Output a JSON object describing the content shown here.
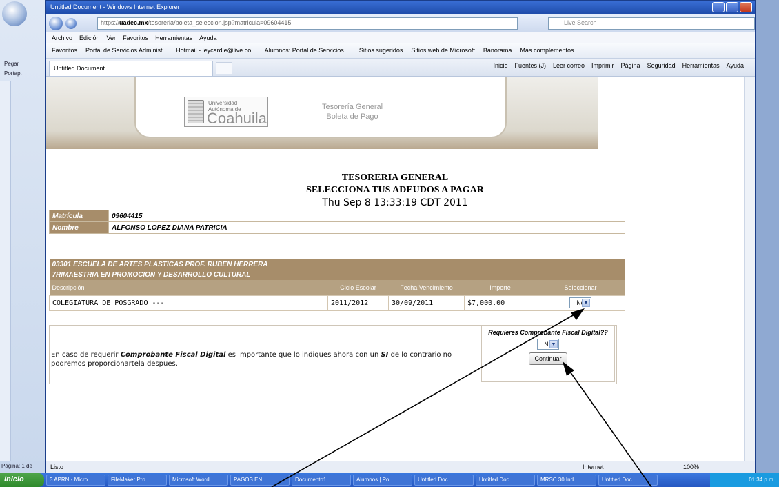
{
  "word": {
    "paste_label": "Pegar",
    "status_page": "Página: 1 de",
    "tools_label": "Portap."
  },
  "ie": {
    "title": "Untitled Document - Windows Internet Explorer",
    "address_prefix": "https://",
    "address_host": "uadec.mx",
    "address_rest": "/tesoreria/boleta_seleccion.jsp?matricula=09604415",
    "search_placeholder": "Live Search",
    "menu": [
      "Archivo",
      "Edición",
      "Ver",
      "Favoritos",
      "Herramientas",
      "Ayuda"
    ],
    "favorites": [
      "Favoritos",
      "Portal de Servicios Administ...",
      "Hotmail - leycardle@live.co...",
      "Alumnos: Portal de Servicios ...",
      "Sitios sugeridos",
      "Sitios web de Microsoft",
      "Banorama",
      "Más complementos"
    ],
    "tab_title": "Untitled Document",
    "command_bar": [
      "Inicio",
      "Fuentes (J)",
      "Leer correo",
      "Imprimir",
      "Página",
      "Seguridad",
      "Herramientas",
      "Ayuda"
    ],
    "status_left": "Listo",
    "status_zone": "Internet",
    "status_zoom": "100%"
  },
  "banner": {
    "uni_small": "Universidad\nAutónoma de",
    "uni_name": "Coahuila",
    "right_line1": "Tesorería General",
    "right_line2": "Boleta de Pago"
  },
  "page": {
    "title1": "TESORERIA GENERAL",
    "title2": "SELECCIONA TUS ADEUDOS A PAGAR",
    "date": "Thu Sep 8 13:33:19 CDT 2011",
    "matricula_label": "Matrícula",
    "matricula_value": "09604415",
    "nombre_label": "Nombre",
    "nombre_value": "ALFONSO LOPEZ DIANA PATRICIA",
    "school": "03301 ESCUELA DE ARTES PLASTICAS PROF. RUBEN HERRERA",
    "program": "7RIMAESTRIA EN PROMOCION Y DESARROLLO CULTURAL",
    "columns": [
      "Descripción",
      "Ciclo Escolar",
      "Fecha Vencimiento",
      "Importe",
      "Seleccionar"
    ],
    "row": {
      "descripcion": "COLEGIATURA DE POSGRADO ---",
      "ciclo": "2011/2012",
      "vencimiento": "30/09/2011",
      "importe": "$7,000.00",
      "seleccionar": "No"
    },
    "cfd_pre": "En caso de requerir ",
    "cfd_bold": "Comprobante Fiscal Digital",
    "cfd_mid": " es importante que lo indiques ahora con un ",
    "cfd_si": "SI",
    "cfd_post": " de lo contrario no podremos proporcionartela despues.",
    "cfd_question": "Requieres Comprobante Fiscal Digital??",
    "cfd_select": "No",
    "continue_label": "Continuar"
  },
  "taskbar": {
    "start": "Inicio",
    "tasks": [
      "3 APRN - Micro...",
      "FileMaker Pro",
      "Microsoft Word",
      "PAGOS EN...",
      "Documento1...",
      "Alumnos | Po...",
      "Untitled Doc...",
      "Untitled Doc...",
      "MRSC 30 Ind...",
      "Untitled Doc..."
    ],
    "clock": "01:34 p.m."
  }
}
